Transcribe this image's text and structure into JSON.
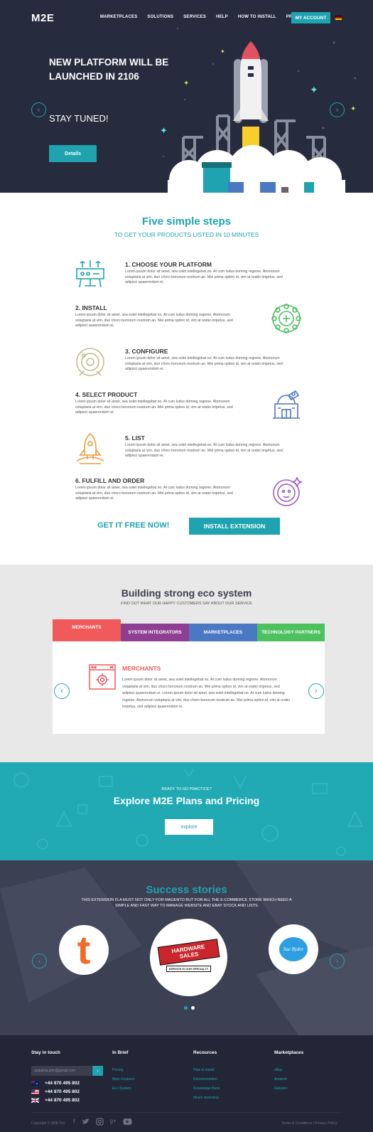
{
  "header": {
    "logo": "M2E",
    "nav": [
      "MARKETPLACES",
      "SOLUTIONS",
      "SERVICES",
      "HELP",
      "HOW TO INSTALL",
      "PRICING"
    ],
    "account": "MY ACCOUNT"
  },
  "hero": {
    "title": "NEW PLATFORM WILL BE LAUNCHED IN 2106",
    "subtitle": "STAY TUNED!",
    "button": "Details",
    "prev": "‹",
    "next": "›"
  },
  "steps": {
    "title": "Five simple steps",
    "subtitle": "TO GET YOUR PRODUCTS LISTED IN 10 MINUTES",
    "items": [
      {
        "title": "1. CHOOSE YOUR PLATFORM",
        "text": "Lorem ipsum dolor sit amet, sea solet intellegebat no. At cum ludus doming regione. Atomorum voluptaria at vim, duo choro bonorum nostrum an. Mei prima option id, vim at oratio impetus, sed adipisci quaerendum ei."
      },
      {
        "title": "2. INSTALL",
        "text": "Lorem ipsum dolor sit amet, sea solet intellegebat no. At cum ludus doming regione. Atomorum voluptaria at vim, duo choro bonorum nostrum an. Mei prima option id, vim at oratio impetus, sed adipisci quaerendum ei."
      },
      {
        "title": "3. CONFIGURE",
        "text": "Lorem ipsum dolor sit amet, sea solet intellegebat no. At cum ludus doming regione. Atomorum voluptaria at vim, duo choro bonorum nostrum an. Mei prima option id, vim at oratio impetus, sed adipisci quaerendum ei."
      },
      {
        "title": "4. SELECT PRODUCT",
        "text": "Lorem ipsum dolor sit amet, sea solet intellegebat no. At cum ludus doming regione. Atomorum voluptaria at vim, duo choro bonorum nostrum an. Mei prima option id, vim at oratio impetus, sed adipisci quaerendum ei."
      },
      {
        "title": "5. LIST",
        "text": "Lorem ipsum dolor sit amet, sea solet intellegebat no. At cum ludus doming regione. Atomorum voluptaria at vim, duo choro bonorum nostrum an. Mei prima option id, vim at oratio impetus, sed adipisci quaerendum ei."
      },
      {
        "title": "6. FULFILL AND ORDER",
        "text": "Lorem ipsum dolor sit amet, sea solet intellegebat no. At cum ludus doming regione. Atomorum voluptaria at vim, duo choro bonorum nostrum an. Mei prima option id, vim at oratio impetus, sed adipisci quaerendum ei."
      }
    ],
    "cta": "GET IT FREE NOW!",
    "install": "INSTALL EXTENSION"
  },
  "eco": {
    "title": "Building strong eco system",
    "subtitle": "FIND OUT WHAT OUR HAPPY CUSTOMERS SAY ABOUT OUR SERVICE",
    "tabs": [
      {
        "label": "MERCHANTS",
        "color": "#f05a5b"
      },
      {
        "label": "SYSTEM INTEGRATORS",
        "color": "#8e3f94"
      },
      {
        "label": "MARKETPLACES",
        "color": "#4a78c2"
      },
      {
        "label": "TECHNOLOGY PARTNERS",
        "color": "#4cc15d"
      }
    ],
    "panel_title": "MERCHANTS",
    "panel_text": "Lorem ipsum dolor sit amet, sea solet intellegebat no. At cum ludus doming regione. Atomorum voluptaria at vim, duo choro bonorum nostrum an. Mei prima option id, vim at oratio impetus, sed adipisci quaerendum ei. Lorem ipsum dolor sit amet, sea solet intellegebat no. At cum ludus doming regione. Atomorum voluptaria at vim, duo choro bonorum nostrum an. Mei prima option id, vim at oratio impetus, sed adipisci quaerendum ei."
  },
  "pricing": {
    "pre": "READY TO GO PRACTICE?",
    "title": "Explore M2E Plans and Pricing",
    "button": "explore"
  },
  "success": {
    "title": "Success stories",
    "text": "THIS EXTENSION IS A MUST NOT ONLY FOR MAGENTO BUT FOR ALL THE E-COMMERCE STORE WHICH NEED A SIMPLE AND FAST WAY TO MANAGE WEBSITE AND EBAY STOCK AND LISTS",
    "clients": [
      "t",
      "HARDWARE SALES",
      "SERVICE IS OUR SPECIALTY",
      "Sue Ryder"
    ]
  },
  "footer": {
    "stay": "Stay in touch",
    "email_placeholder": "alabama.john@gmail.com",
    "go": "›",
    "phones": [
      "+44 870 495 802",
      "+44 870 495 802",
      "+44 870 495 802"
    ],
    "brief_title": "In Brief",
    "brief": [
      "Pricing",
      "Main Features",
      "Eco System"
    ],
    "resources_title": "Recources",
    "resources": [
      "How to install",
      "Documentation",
      "Knowledge Base",
      "Idea's workshop"
    ],
    "markets_title": "Marketplaces",
    "markets": [
      "eBay",
      "Amazon",
      "Rakuten"
    ],
    "copyright": "Copyright © M2E Pro",
    "terms": "Terms & Conditions | Privacy Policy"
  }
}
